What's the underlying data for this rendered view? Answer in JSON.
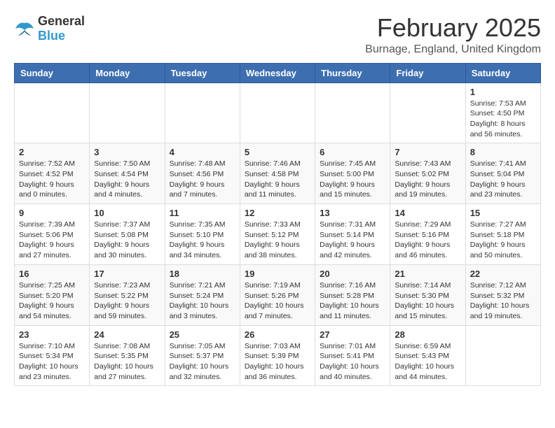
{
  "header": {
    "logo_general": "General",
    "logo_blue": "Blue",
    "month_title": "February 2025",
    "location": "Burnage, England, United Kingdom"
  },
  "weekdays": [
    "Sunday",
    "Monday",
    "Tuesday",
    "Wednesday",
    "Thursday",
    "Friday",
    "Saturday"
  ],
  "weeks": [
    [
      {
        "day": "",
        "info": ""
      },
      {
        "day": "",
        "info": ""
      },
      {
        "day": "",
        "info": ""
      },
      {
        "day": "",
        "info": ""
      },
      {
        "day": "",
        "info": ""
      },
      {
        "day": "",
        "info": ""
      },
      {
        "day": "1",
        "info": "Sunrise: 7:53 AM\nSunset: 4:50 PM\nDaylight: 8 hours and 56 minutes."
      }
    ],
    [
      {
        "day": "2",
        "info": "Sunrise: 7:52 AM\nSunset: 4:52 PM\nDaylight: 9 hours and 0 minutes."
      },
      {
        "day": "3",
        "info": "Sunrise: 7:50 AM\nSunset: 4:54 PM\nDaylight: 9 hours and 4 minutes."
      },
      {
        "day": "4",
        "info": "Sunrise: 7:48 AM\nSunset: 4:56 PM\nDaylight: 9 hours and 7 minutes."
      },
      {
        "day": "5",
        "info": "Sunrise: 7:46 AM\nSunset: 4:58 PM\nDaylight: 9 hours and 11 minutes."
      },
      {
        "day": "6",
        "info": "Sunrise: 7:45 AM\nSunset: 5:00 PM\nDaylight: 9 hours and 15 minutes."
      },
      {
        "day": "7",
        "info": "Sunrise: 7:43 AM\nSunset: 5:02 PM\nDaylight: 9 hours and 19 minutes."
      },
      {
        "day": "8",
        "info": "Sunrise: 7:41 AM\nSunset: 5:04 PM\nDaylight: 9 hours and 23 minutes."
      }
    ],
    [
      {
        "day": "9",
        "info": "Sunrise: 7:39 AM\nSunset: 5:06 PM\nDaylight: 9 hours and 27 minutes."
      },
      {
        "day": "10",
        "info": "Sunrise: 7:37 AM\nSunset: 5:08 PM\nDaylight: 9 hours and 30 minutes."
      },
      {
        "day": "11",
        "info": "Sunrise: 7:35 AM\nSunset: 5:10 PM\nDaylight: 9 hours and 34 minutes."
      },
      {
        "day": "12",
        "info": "Sunrise: 7:33 AM\nSunset: 5:12 PM\nDaylight: 9 hours and 38 minutes."
      },
      {
        "day": "13",
        "info": "Sunrise: 7:31 AM\nSunset: 5:14 PM\nDaylight: 9 hours and 42 minutes."
      },
      {
        "day": "14",
        "info": "Sunrise: 7:29 AM\nSunset: 5:16 PM\nDaylight: 9 hours and 46 minutes."
      },
      {
        "day": "15",
        "info": "Sunrise: 7:27 AM\nSunset: 5:18 PM\nDaylight: 9 hours and 50 minutes."
      }
    ],
    [
      {
        "day": "16",
        "info": "Sunrise: 7:25 AM\nSunset: 5:20 PM\nDaylight: 9 hours and 54 minutes."
      },
      {
        "day": "17",
        "info": "Sunrise: 7:23 AM\nSunset: 5:22 PM\nDaylight: 9 hours and 59 minutes."
      },
      {
        "day": "18",
        "info": "Sunrise: 7:21 AM\nSunset: 5:24 PM\nDaylight: 10 hours and 3 minutes."
      },
      {
        "day": "19",
        "info": "Sunrise: 7:19 AM\nSunset: 5:26 PM\nDaylight: 10 hours and 7 minutes."
      },
      {
        "day": "20",
        "info": "Sunrise: 7:16 AM\nSunset: 5:28 PM\nDaylight: 10 hours and 11 minutes."
      },
      {
        "day": "21",
        "info": "Sunrise: 7:14 AM\nSunset: 5:30 PM\nDaylight: 10 hours and 15 minutes."
      },
      {
        "day": "22",
        "info": "Sunrise: 7:12 AM\nSunset: 5:32 PM\nDaylight: 10 hours and 19 minutes."
      }
    ],
    [
      {
        "day": "23",
        "info": "Sunrise: 7:10 AM\nSunset: 5:34 PM\nDaylight: 10 hours and 23 minutes."
      },
      {
        "day": "24",
        "info": "Sunrise: 7:08 AM\nSunset: 5:35 PM\nDaylight: 10 hours and 27 minutes."
      },
      {
        "day": "25",
        "info": "Sunrise: 7:05 AM\nSunset: 5:37 PM\nDaylight: 10 hours and 32 minutes."
      },
      {
        "day": "26",
        "info": "Sunrise: 7:03 AM\nSunset: 5:39 PM\nDaylight: 10 hours and 36 minutes."
      },
      {
        "day": "27",
        "info": "Sunrise: 7:01 AM\nSunset: 5:41 PM\nDaylight: 10 hours and 40 minutes."
      },
      {
        "day": "28",
        "info": "Sunrise: 6:59 AM\nSunset: 5:43 PM\nDaylight: 10 hours and 44 minutes."
      },
      {
        "day": "",
        "info": ""
      }
    ]
  ]
}
